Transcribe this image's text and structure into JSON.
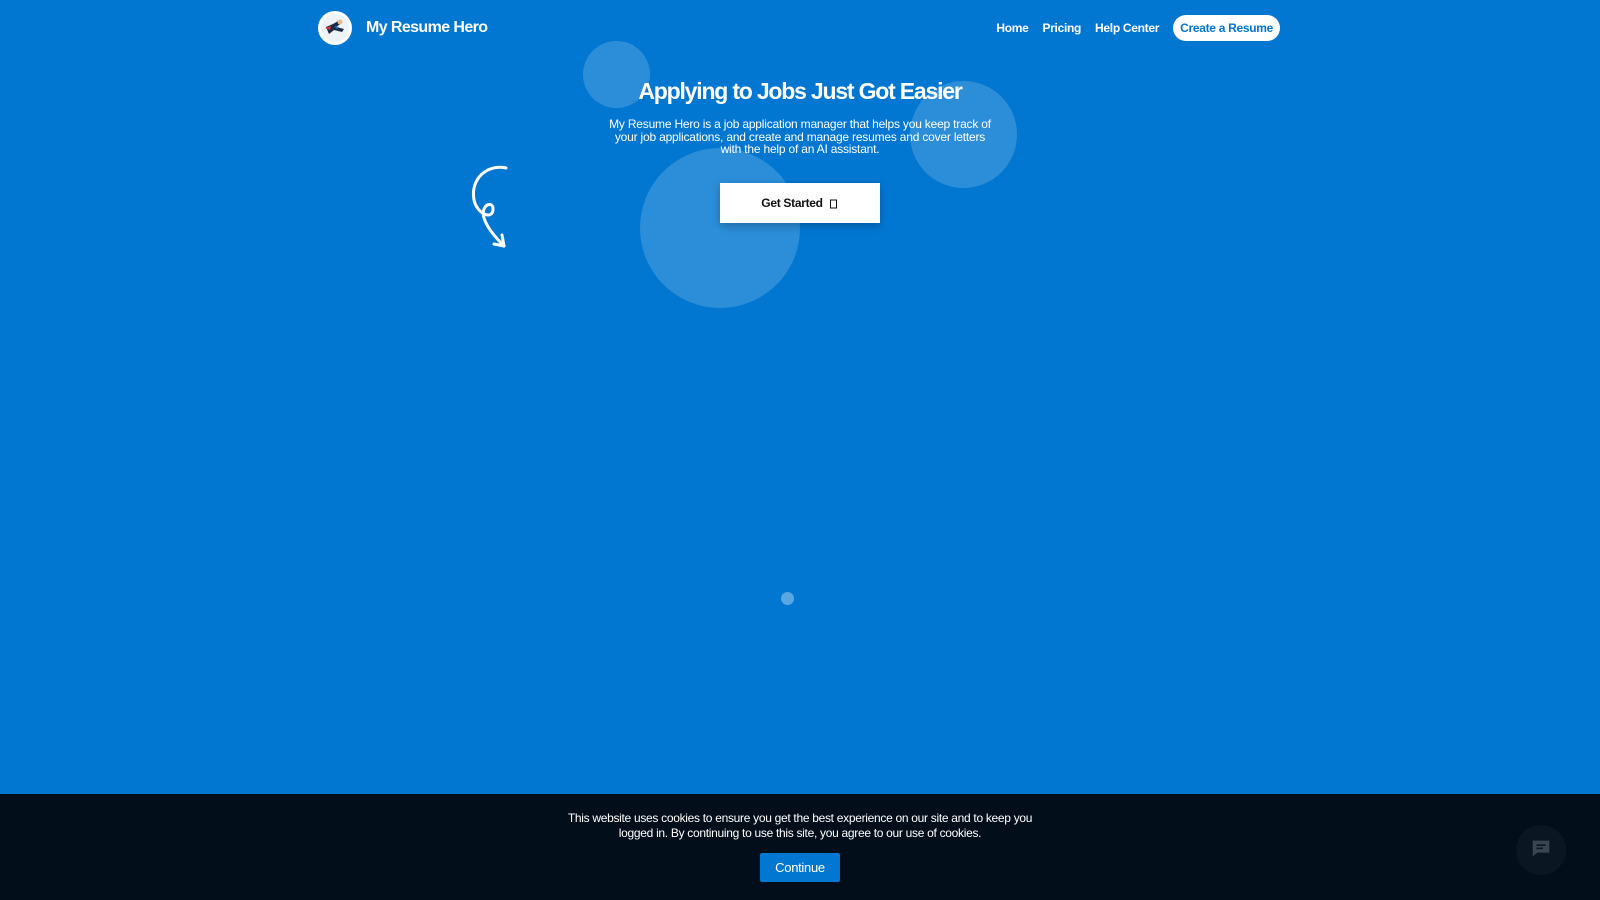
{
  "header": {
    "brand_name": "My Resume Hero",
    "nav": [
      {
        "label": "Home"
      },
      {
        "label": "Pricing"
      },
      {
        "label": "Help Center"
      }
    ],
    "cta_label": "Create a Resume"
  },
  "hero": {
    "title": "Applying to Jobs Just Got Easier",
    "description": "My Resume Hero is a job application manager that helps you keep track of your job applications, and create and manage resumes and cover letters with the help of an AI assistant.",
    "button_label": "Get Started"
  },
  "cookie_banner": {
    "text": "This website uses cookies to ensure you get the best experience on our site and to keep you logged in. By continuing to use this site, you agree to our use of cookies.",
    "button_label": "Continue"
  },
  "icons": {
    "logo": "superhero-logo-icon",
    "button_arrow": "arrow-right-icon",
    "doodle": "curly-arrow-icon",
    "chat": "chat-bubble-icon"
  },
  "colors": {
    "background": "#0277d2",
    "cookie_bar": "#020f1a",
    "button_bg": "#ffffff",
    "continue_bg": "#0277d2"
  }
}
